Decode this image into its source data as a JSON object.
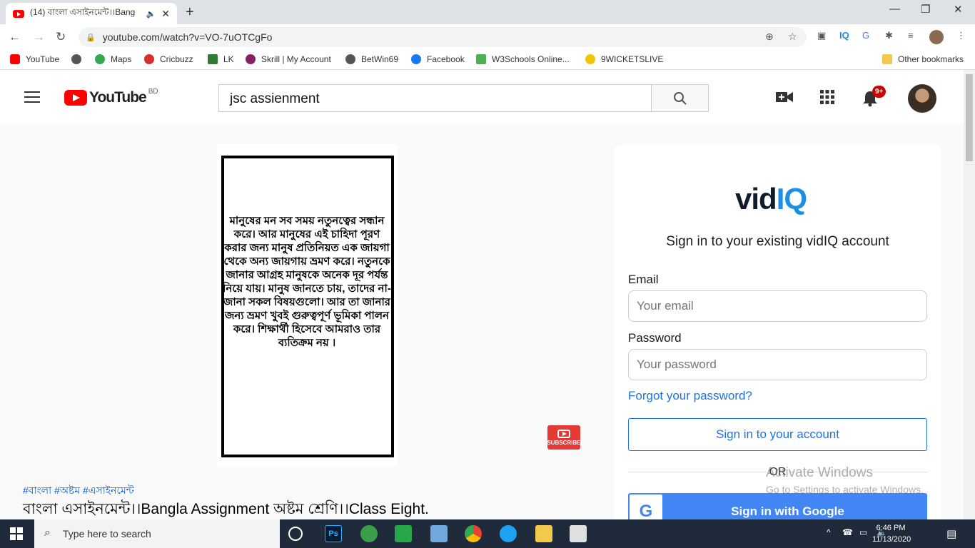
{
  "browser": {
    "tab_title": "(14) বাংলা এসাইনমেন্ট।।Bang",
    "url": "youtube.com/watch?v=VO-7uOTCgFo",
    "bookmarks": [
      {
        "label": "YouTube",
        "color": "#ff0000"
      },
      {
        "label": "",
        "color": "#555555"
      },
      {
        "label": "Maps",
        "color": "#34a853"
      },
      {
        "label": "Cricbuzz",
        "color": "#d32f2f"
      },
      {
        "label": "LK",
        "color": "#2e7d32"
      },
      {
        "label": "Skrill | My Account",
        "color": "#862165"
      },
      {
        "label": "BetWin69",
        "color": "#555555"
      },
      {
        "label": "Facebook",
        "color": "#1877f2"
      },
      {
        "label": "W3Schools Online...",
        "color": "#4caf50"
      },
      {
        "label": "9WICKETSLIVE",
        "color": "#f5c400"
      }
    ],
    "other_bookmarks": "Other bookmarks",
    "ext_iq": "IQ"
  },
  "youtube": {
    "logo_word": "YouTube",
    "country_code": "BD",
    "search_value": "jsc assienment",
    "notification_badge": "9+"
  },
  "video": {
    "text": "মানুষের মন সব সময় নতুনত্বের সন্ধান করে। আর মানুষের এই চাহিদা পূরণ করার জন্য মানুষ প্রতিনিয়ত এক জায়গা থেকে অন্য জায়গায় ভ্রমণ করে। নতুনকে জানার আগ্রহ মানুষকে অনেক দূর পর্যন্ত নিয়ে যায়। মানুষ জানতে চায়, তাদের না-জানা সকল বিষয়গুলো। আর তা জানার জন্য ভ্রমণ খুবই গুরুত্বপূর্ণ ভূমিকা পালন করে। শিক্ষার্থী হিসেবে আমরাও তার ব্যতিক্রম নয় ।",
    "subscribe_label": "SUBSCRIBE",
    "hashtags": "#বাংলা #অষ্টম #এসাইনমেন্ট",
    "title": "বাংলা এসাইনমেন্ট।।Bangla Assignment অষ্টম শ্রেণি।।Class Eight."
  },
  "vidiq": {
    "logo_part1": "vid",
    "logo_part2": "IQ",
    "heading": "Sign in to your existing vidIQ account",
    "email_label": "Email",
    "email_placeholder": "Your email",
    "password_label": "Password",
    "password_placeholder": "Your password",
    "forgot": "Forgot your password?",
    "signin_button": "Sign in to your account",
    "or": "OR",
    "google_button": "Sign in with Google",
    "accent": "#1a73e8"
  },
  "watermark": {
    "line1": "Activate Windows",
    "line2": "Go to Settings to activate Windows."
  },
  "taskbar": {
    "search_placeholder": "Type here to search",
    "time": "6:46 PM",
    "date": "11/13/2020"
  }
}
